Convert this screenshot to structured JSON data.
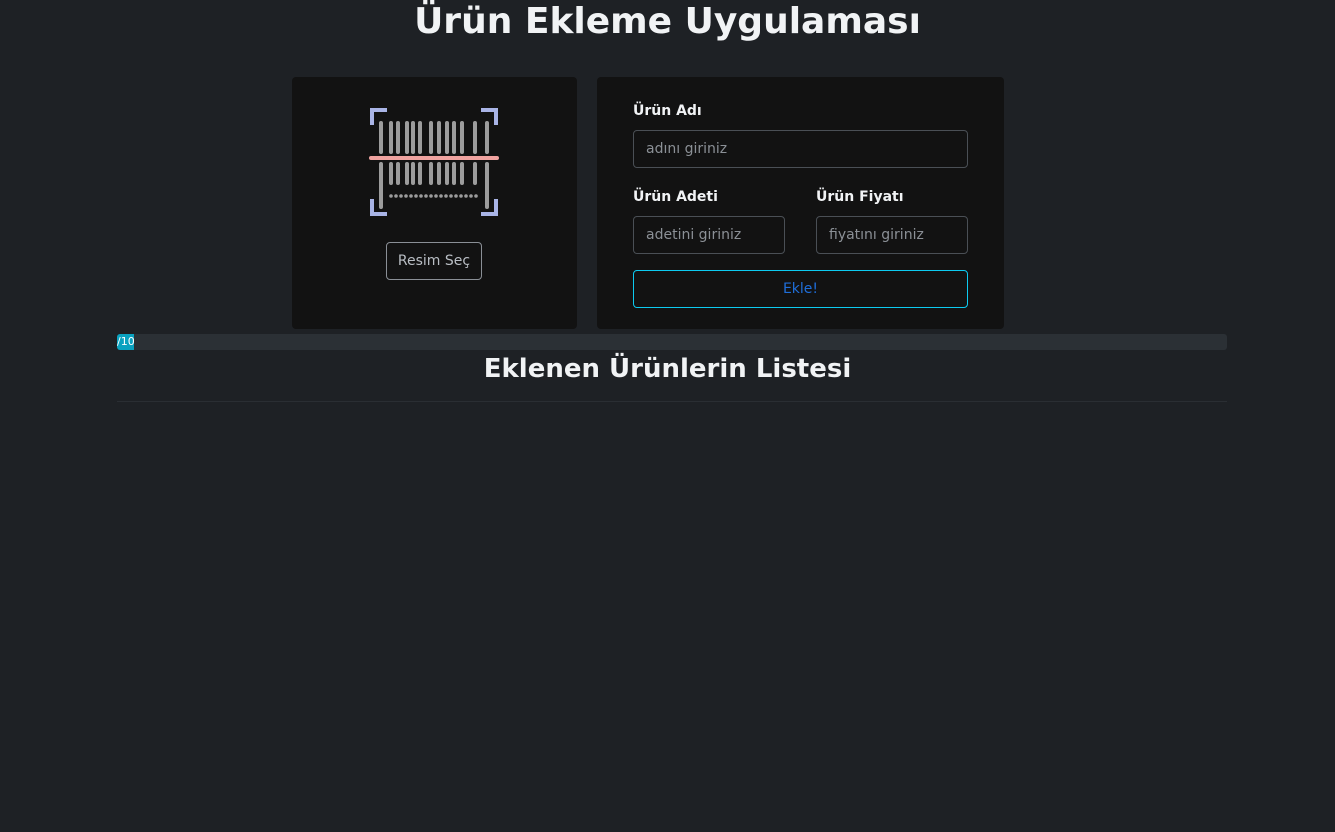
{
  "app": {
    "title": "Ürün Ekleme Uygulaması"
  },
  "image_panel": {
    "icon": "barcode-scan-icon",
    "choose_button_label": "Resim Seç"
  },
  "form": {
    "name": {
      "label": "Ürün Adı",
      "value": "",
      "placeholder": "adını giriniz"
    },
    "quantity": {
      "label": "Ürün Adeti",
      "value": "",
      "placeholder": "adetini giriniz"
    },
    "price": {
      "label": "Ürün Fiyatı",
      "value": "",
      "placeholder": "fiyatını giriniz"
    },
    "submit_label": "Ekle!"
  },
  "progress": {
    "value": 0,
    "max": 10,
    "text": "/10"
  },
  "list": {
    "title": "Eklenen Ürünlerin Listesi",
    "items": []
  },
  "colors": {
    "background": "#1e2125",
    "card": "#121212",
    "accent_info": "#0dcaf0",
    "scan_line": "#f0a3a0",
    "frame_corners": "#a9b4e6"
  }
}
